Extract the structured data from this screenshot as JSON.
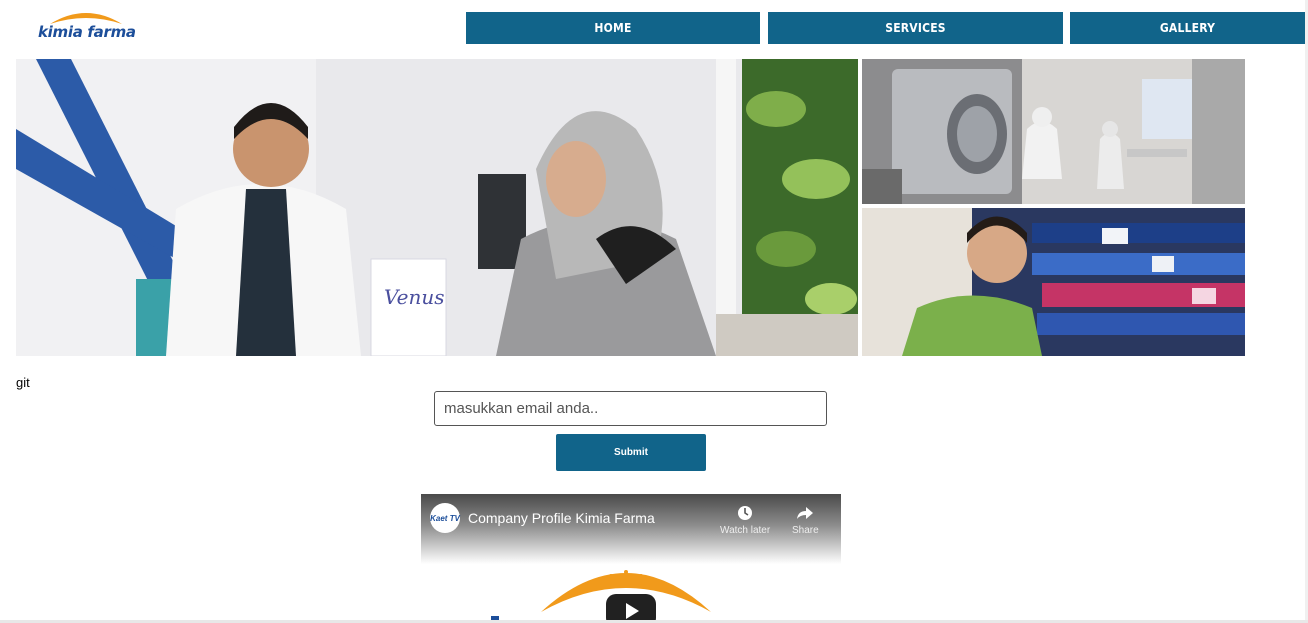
{
  "brand": {
    "logo_text": "kimia farma"
  },
  "nav": {
    "items": [
      {
        "label": "HOME"
      },
      {
        "label": "SERVICES"
      },
      {
        "label": "GALLERY"
      }
    ]
  },
  "colors": {
    "primary": "#11648a",
    "logo_orange": "#f19a1b",
    "logo_blue": "#1c4e9a"
  },
  "gallery": {
    "main": "pharmacist-consultation-photo",
    "top_right": "lab-cleanroom-photo",
    "bottom_right": "pharmacy-shopper-photo"
  },
  "content": {
    "label": "git"
  },
  "subscribe": {
    "placeholder": "masukkan email anda..",
    "submit_label": "Submit"
  },
  "video": {
    "title": "Company Profile Kimia Farma",
    "channel": "Kaet TV",
    "watch_later": "Watch later",
    "share": "Share"
  }
}
